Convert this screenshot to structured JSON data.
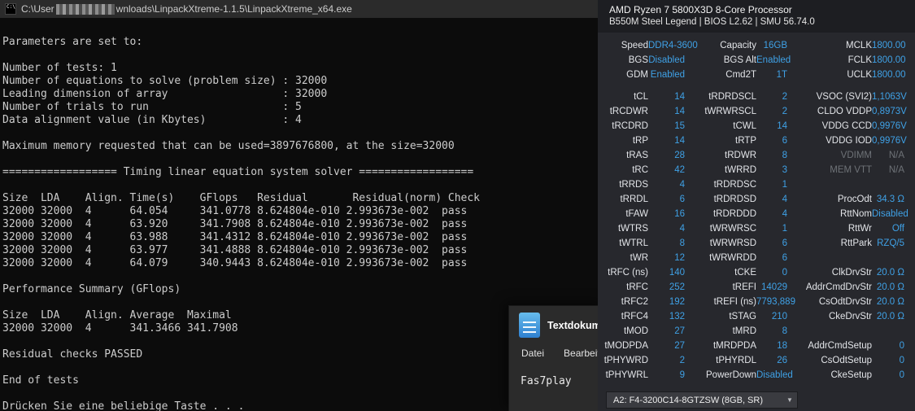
{
  "terminal": {
    "icon_text": "C:\\",
    "title_prefix": "C:\\User",
    "title_suffix": "wnloads\\LinpackXtreme-1.1.5\\LinpackXtreme_x64.exe",
    "lines": [
      "Parameters are set to:",
      "",
      "Number of tests: 1",
      "Number of equations to solve (problem size) : 32000",
      "Leading dimension of array                  : 32000",
      "Number of trials to run                     : 5",
      "Data alignment value (in Kbytes)            : 4",
      "",
      "Maximum memory requested that can be used=3897676800, at the size=32000",
      "",
      "================== Timing linear equation system solver ==================",
      "",
      "Size  LDA    Align. Time(s)    GFlops   Residual       Residual(norm) Check",
      "32000 32000  4      64.054     341.0778 8.624804e-010 2.993673e-002  pass",
      "32000 32000  4      63.920     341.7908 8.624804e-010 2.993673e-002  pass",
      "32000 32000  4      63.988     341.4312 8.624804e-010 2.993673e-002  pass",
      "32000 32000  4      63.977     341.4888 8.624804e-010 2.993673e-002  pass",
      "32000 32000  4      64.079     340.9443 8.624804e-010 2.993673e-002  pass",
      "",
      "Performance Summary (GFlops)",
      "",
      "Size  LDA    Align. Average  Maximal",
      "32000 32000  4      341.3466 341.7908",
      "",
      "Residual checks PASSED",
      "",
      "End of tests",
      "",
      "Drücken Sie eine beliebige Taste . . ."
    ]
  },
  "notepad": {
    "tab_label": "Textdokument",
    "menu": [
      "Datei",
      "Bearbeiten"
    ],
    "content": "Fas7play"
  },
  "zentimings": {
    "header": {
      "cpu": "AMD Ryzen 7 5800X3D 8-Core Processor",
      "board": "B550M Steel Legend | BIOS L2.62 | SMU 56.74.0"
    },
    "colors": {
      "value_blue": "#3fa1e6",
      "na_gray": "#6e7277",
      "panel_bg": "#27282d",
      "header_bg": "#1d1e22"
    },
    "sections": [
      [
        [
          [
            "Speed",
            "DDR4-3600"
          ],
          [
            "Capacity",
            "16GB"
          ],
          [
            "MCLK",
            "1800.00"
          ]
        ],
        [
          [
            "BGS",
            "Disabled"
          ],
          [
            "BGS Alt",
            "Enabled"
          ],
          [
            "FCLK",
            "1800.00"
          ]
        ],
        [
          [
            "GDM",
            "Enabled"
          ],
          [
            "Cmd2T",
            "1T"
          ],
          [
            "UCLK",
            "1800.00"
          ]
        ]
      ],
      [
        [
          [
            "tCL",
            "14"
          ],
          [
            "tRDRDSCL",
            "2"
          ],
          [
            "VSOC (SVI2)",
            "1,1063V"
          ]
        ],
        [
          [
            "tRCDWR",
            "14"
          ],
          [
            "tWRWRSCL",
            "2"
          ],
          [
            "CLDO VDDP",
            "0,8973V"
          ]
        ],
        [
          [
            "tRCDRD",
            "15"
          ],
          [
            "tCWL",
            "14"
          ],
          [
            "VDDG CCD",
            "0,9976V"
          ]
        ],
        [
          [
            "tRP",
            "14"
          ],
          [
            "tRTP",
            "6"
          ],
          [
            "VDDG IOD",
            "0,9976V"
          ]
        ],
        [
          [
            "tRAS",
            "28"
          ],
          [
            "tRDWR",
            "8"
          ],
          [
            "VDIMM",
            "N/A",
            "dim"
          ]
        ],
        [
          [
            "tRC",
            "42"
          ],
          [
            "tWRRD",
            "3"
          ],
          [
            "MEM VTT",
            "N/A",
            "dim"
          ]
        ],
        [
          [
            "tRRDS",
            "4"
          ],
          [
            "tRDRDSC",
            "1"
          ],
          null
        ],
        [
          [
            "tRRDL",
            "6"
          ],
          [
            "tRDRDSD",
            "4"
          ],
          [
            "ProcOdt",
            "34.3 Ω"
          ]
        ],
        [
          [
            "tFAW",
            "16"
          ],
          [
            "tRDRDDD",
            "4"
          ],
          [
            "RttNom",
            "Disabled"
          ]
        ],
        [
          [
            "tWTRS",
            "4"
          ],
          [
            "tWRWRSC",
            "1"
          ],
          [
            "RttWr",
            "Off"
          ]
        ],
        [
          [
            "tWTRL",
            "8"
          ],
          [
            "tWRWRSD",
            "6"
          ],
          [
            "RttPark",
            "RZQ/5"
          ]
        ],
        [
          [
            "tWR",
            "12"
          ],
          [
            "tWRWRDD",
            "6"
          ],
          null
        ],
        [
          [
            "tRFC (ns)",
            "140"
          ],
          [
            "tCKE",
            "0"
          ],
          [
            "ClkDrvStr",
            "20.0 Ω"
          ]
        ],
        [
          [
            "tRFC",
            "252"
          ],
          [
            "tREFI",
            "14029"
          ],
          [
            "AddrCmdDrvStr",
            "20.0 Ω"
          ]
        ],
        [
          [
            "tRFC2",
            "192"
          ],
          [
            "tREFI (ns)",
            "7793,889"
          ],
          [
            "CsOdtDrvStr",
            "20.0 Ω"
          ]
        ],
        [
          [
            "tRFC4",
            "132"
          ],
          [
            "tSTAG",
            "210"
          ],
          [
            "CkeDrvStr",
            "20.0 Ω"
          ]
        ],
        [
          [
            "tMOD",
            "27"
          ],
          [
            "tMRD",
            "8"
          ],
          null
        ],
        [
          [
            "tMODPDA",
            "27"
          ],
          [
            "tMRDPDA",
            "18"
          ],
          [
            "AddrCmdSetup",
            "0"
          ]
        ],
        [
          [
            "tPHYWRD",
            "2"
          ],
          [
            "tPHYRDL",
            "26"
          ],
          [
            "CsOdtSetup",
            "0"
          ]
        ],
        [
          [
            "tPHYWRL",
            "9"
          ],
          [
            "PowerDown",
            "Disabled"
          ],
          [
            "CkeSetup",
            "0"
          ]
        ]
      ]
    ],
    "dropdown": {
      "value": "A2: F4-3200C14-8GTZSW (8GB, SR)",
      "caret_icon": "▼"
    }
  }
}
